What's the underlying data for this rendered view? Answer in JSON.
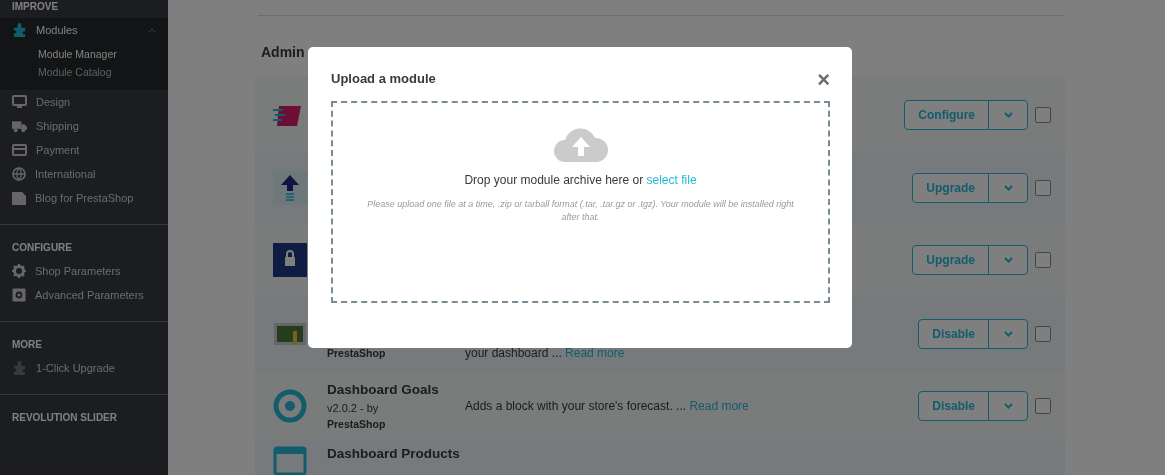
{
  "sidebar": {
    "sections": [
      {
        "title": "IMPROVE",
        "items": [
          {
            "label": "Modules",
            "selected": true,
            "expanded": true,
            "children": [
              {
                "label": "Module Manager",
                "selected": true
              },
              {
                "label": "Module Catalog",
                "selected": false
              }
            ]
          },
          {
            "label": "Design",
            "selected": false
          },
          {
            "label": "Shipping",
            "selected": false
          },
          {
            "label": "Payment",
            "selected": false
          },
          {
            "label": "International",
            "selected": false
          },
          {
            "label": "Blog for PrestaShop",
            "selected": false
          }
        ]
      },
      {
        "title": "CONFIGURE",
        "items": [
          {
            "label": "Shop Parameters",
            "selected": false
          },
          {
            "label": "Advanced Parameters",
            "selected": false
          }
        ]
      },
      {
        "title": "MORE",
        "items": [
          {
            "label": "1-Click Upgrade",
            "selected": false
          }
        ]
      },
      {
        "title": "REVOLUTION SLIDER"
      }
    ]
  },
  "page": {
    "heading": "Admin"
  },
  "modules": [
    {
      "action": "Configure",
      "checked": false
    },
    {
      "action": "Upgrade",
      "checked": false
    },
    {
      "action": "Upgrade",
      "checked": false
    },
    {
      "author": "PrestaShop",
      "description": "your dashboard ...",
      "read_more": "Read more",
      "action": "Disable",
      "checked": false
    },
    {
      "name": "Dashboard Goals",
      "version": "v2.0.2 - by",
      "author": "PrestaShop",
      "description": "Adds a block with your store's forecast. ...",
      "read_more": "Read more",
      "action": "Disable",
      "checked": false
    },
    {
      "name": "Dashboard Products"
    }
  ],
  "modal": {
    "title": "Upload a module",
    "close": "×",
    "drop_text": "Drop your module archive here or",
    "select_link": "select file",
    "hint": "Please upload one file at a time, .zip or tarball format (.tar, .tar.gz or .tgz). Your module will be installed right after that."
  }
}
